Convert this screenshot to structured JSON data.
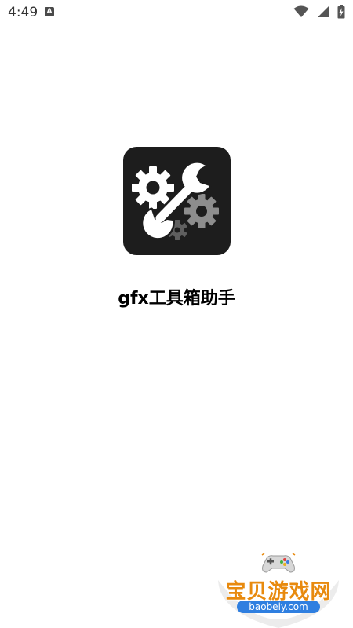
{
  "status_bar": {
    "time": "4:49",
    "notification_letter": "A",
    "icons": [
      "wifi-icon",
      "signal-icon",
      "battery-icon"
    ]
  },
  "app": {
    "name": "gfx工具箱助手",
    "icon": "wrench-gears-icon",
    "icon_background": "#1d1d1d"
  },
  "watermark": {
    "title": "宝贝游戏网",
    "domain": "baobeiy.com",
    "title_color": "#e88a0e",
    "domain_color": "#2f7fe0",
    "icon": "game-controller-icon"
  }
}
